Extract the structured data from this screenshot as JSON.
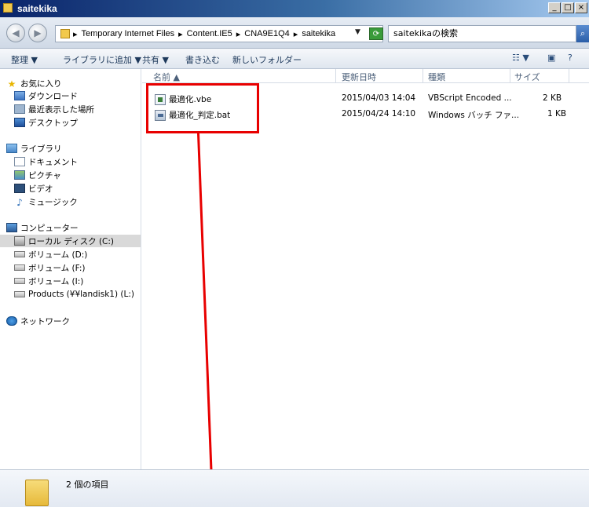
{
  "window": {
    "title": "saitekika",
    "controls": {
      "minimize": "_",
      "maximize": "□",
      "close": "×"
    }
  },
  "address": {
    "path": [
      "Temporary Internet Files",
      "Content.IE5",
      "CNA9E1Q4",
      "saitekika"
    ],
    "separator": "▸",
    "search_placeholder": "saitekikaの検索"
  },
  "toolbar": {
    "organize": "整理 ▼",
    "add_to_library": "ライブラリに追加 ▼",
    "share": "共有 ▼",
    "burn": "書き込む",
    "new_folder": "新しいフォルダー"
  },
  "nav": {
    "favorites": "お気に入り",
    "downloads": "ダウンロード",
    "recent": "最近表示した場所",
    "desktop": "デスクトップ",
    "libraries": "ライブラリ",
    "documents": "ドキュメント",
    "pictures": "ピクチャ",
    "videos": "ビデオ",
    "music": "ミュージック",
    "computer": "コンピューター",
    "local_disk": "ローカル ディスク (C:)",
    "vol_d": "ボリューム (D:)",
    "vol_f": "ボリューム (F:)",
    "vol_i": "ボリューム (I:)",
    "products": "Products (¥¥landisk1) (L:)",
    "network": "ネットワーク"
  },
  "columns": {
    "name": "名前 ▲",
    "date": "更新日時",
    "type": "種類",
    "size": "サイズ"
  },
  "files": [
    {
      "name": "最適化.vbe",
      "date": "2015/04/03 14:04",
      "type": "VBScript Encoded ...",
      "size": "2 KB"
    },
    {
      "name": "最適化_判定.bat",
      "date": "2015/04/24 14:10",
      "type": "Windows バッチ ファ...",
      "size": "1 KB"
    }
  ],
  "status": {
    "item_count": "2 個の項目"
  },
  "colors": {
    "annotation": "#e80000",
    "titlebar": "#0a246a"
  }
}
